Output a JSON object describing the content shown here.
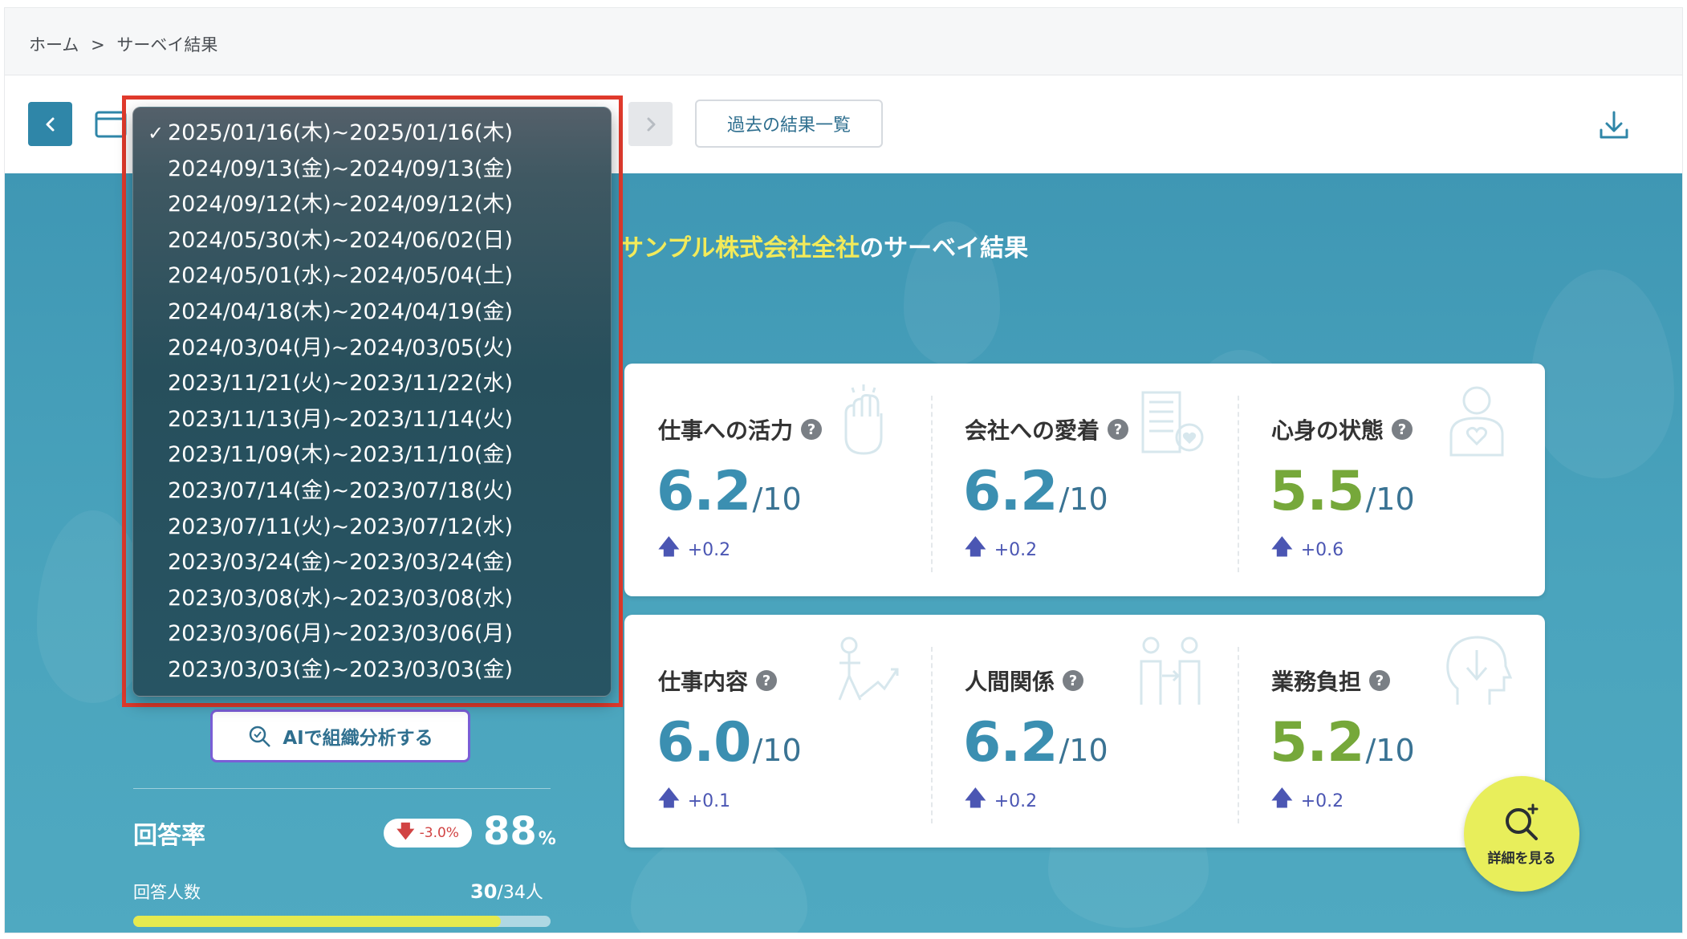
{
  "breadcrumb": {
    "home": "ホーム",
    "separator": ">",
    "current": "サーベイ結果"
  },
  "toolbar": {
    "prev_icon": "chevron-left-icon",
    "next_icon": "chevron-right-icon",
    "history_button": "過去の結果一覧",
    "download_icon": "download-icon"
  },
  "period_dropdown": {
    "selected_index": 0,
    "check_mark": "✓",
    "options": [
      "2025/01/16(木)~2025/01/16(木)",
      "2024/09/13(金)~2024/09/13(金)",
      "2024/09/12(木)~2024/09/12(木)",
      "2024/05/30(木)~2024/06/02(日)",
      "2024/05/01(水)~2024/05/04(土)",
      "2024/04/18(木)~2024/04/19(金)",
      "2024/03/04(月)~2024/03/05(火)",
      "2023/11/21(火)~2023/11/22(水)",
      "2023/11/13(月)~2023/11/14(火)",
      "2023/11/09(木)~2023/11/10(金)",
      "2023/07/14(金)~2023/07/18(火)",
      "2023/07/11(火)~2023/07/12(水)",
      "2023/03/24(金)~2023/03/24(金)",
      "2023/03/08(水)~2023/03/08(水)",
      "2023/03/06(月)~2023/03/06(月)",
      "2023/03/03(金)~2023/03/03(金)"
    ]
  },
  "banner": {
    "company": "サンプル株式会社全社",
    "suffix": "のサーベイ結果"
  },
  "metrics": [
    {
      "label": "仕事への活力",
      "value": "6.2",
      "denominator": "/10",
      "change": "+0.2",
      "color": "#3b8fb1",
      "icon": "fist-icon"
    },
    {
      "label": "会社への愛着",
      "value": "6.2",
      "denominator": "/10",
      "change": "+0.2",
      "color": "#3b8fb1",
      "icon": "building-heart-icon"
    },
    {
      "label": "心身の状態",
      "value": "5.5",
      "denominator": "/10",
      "change": "+0.6",
      "color": "#76a83a",
      "icon": "person-heart-icon"
    },
    {
      "label": "仕事内容",
      "value": "6.0",
      "denominator": "/10",
      "change": "+0.1",
      "color": "#3b8fb1",
      "icon": "climbing-person-icon"
    },
    {
      "label": "人間関係",
      "value": "6.2",
      "denominator": "/10",
      "change": "+0.2",
      "color": "#3b8fb1",
      "icon": "two-people-icon"
    },
    {
      "label": "業務負担",
      "value": "5.2",
      "denominator": "/10",
      "change": "+0.2",
      "color": "#76a83a",
      "icon": "head-down-arrow-icon"
    }
  ],
  "help_icon_glyph": "?",
  "change_arrow": "🡅",
  "ai_button": {
    "label": "AIで組織分析する",
    "icon": "ai-analysis-icon"
  },
  "response": {
    "title": "回答率",
    "change": "-3.0%",
    "change_arrow": "🡇",
    "rate": "88",
    "rate_unit": "%",
    "respondents_label": "回答人数",
    "respondents": "30",
    "total": "/34人",
    "progress_fraction": 0.88
  },
  "detail_button": {
    "label": "詳細を見る",
    "icon": "search-plus-icon"
  },
  "colors": {
    "accent": "#2f86a8",
    "banner": "#4aa4bd",
    "highlight": "#e03a2c",
    "yellow": "#e8ee5b"
  }
}
